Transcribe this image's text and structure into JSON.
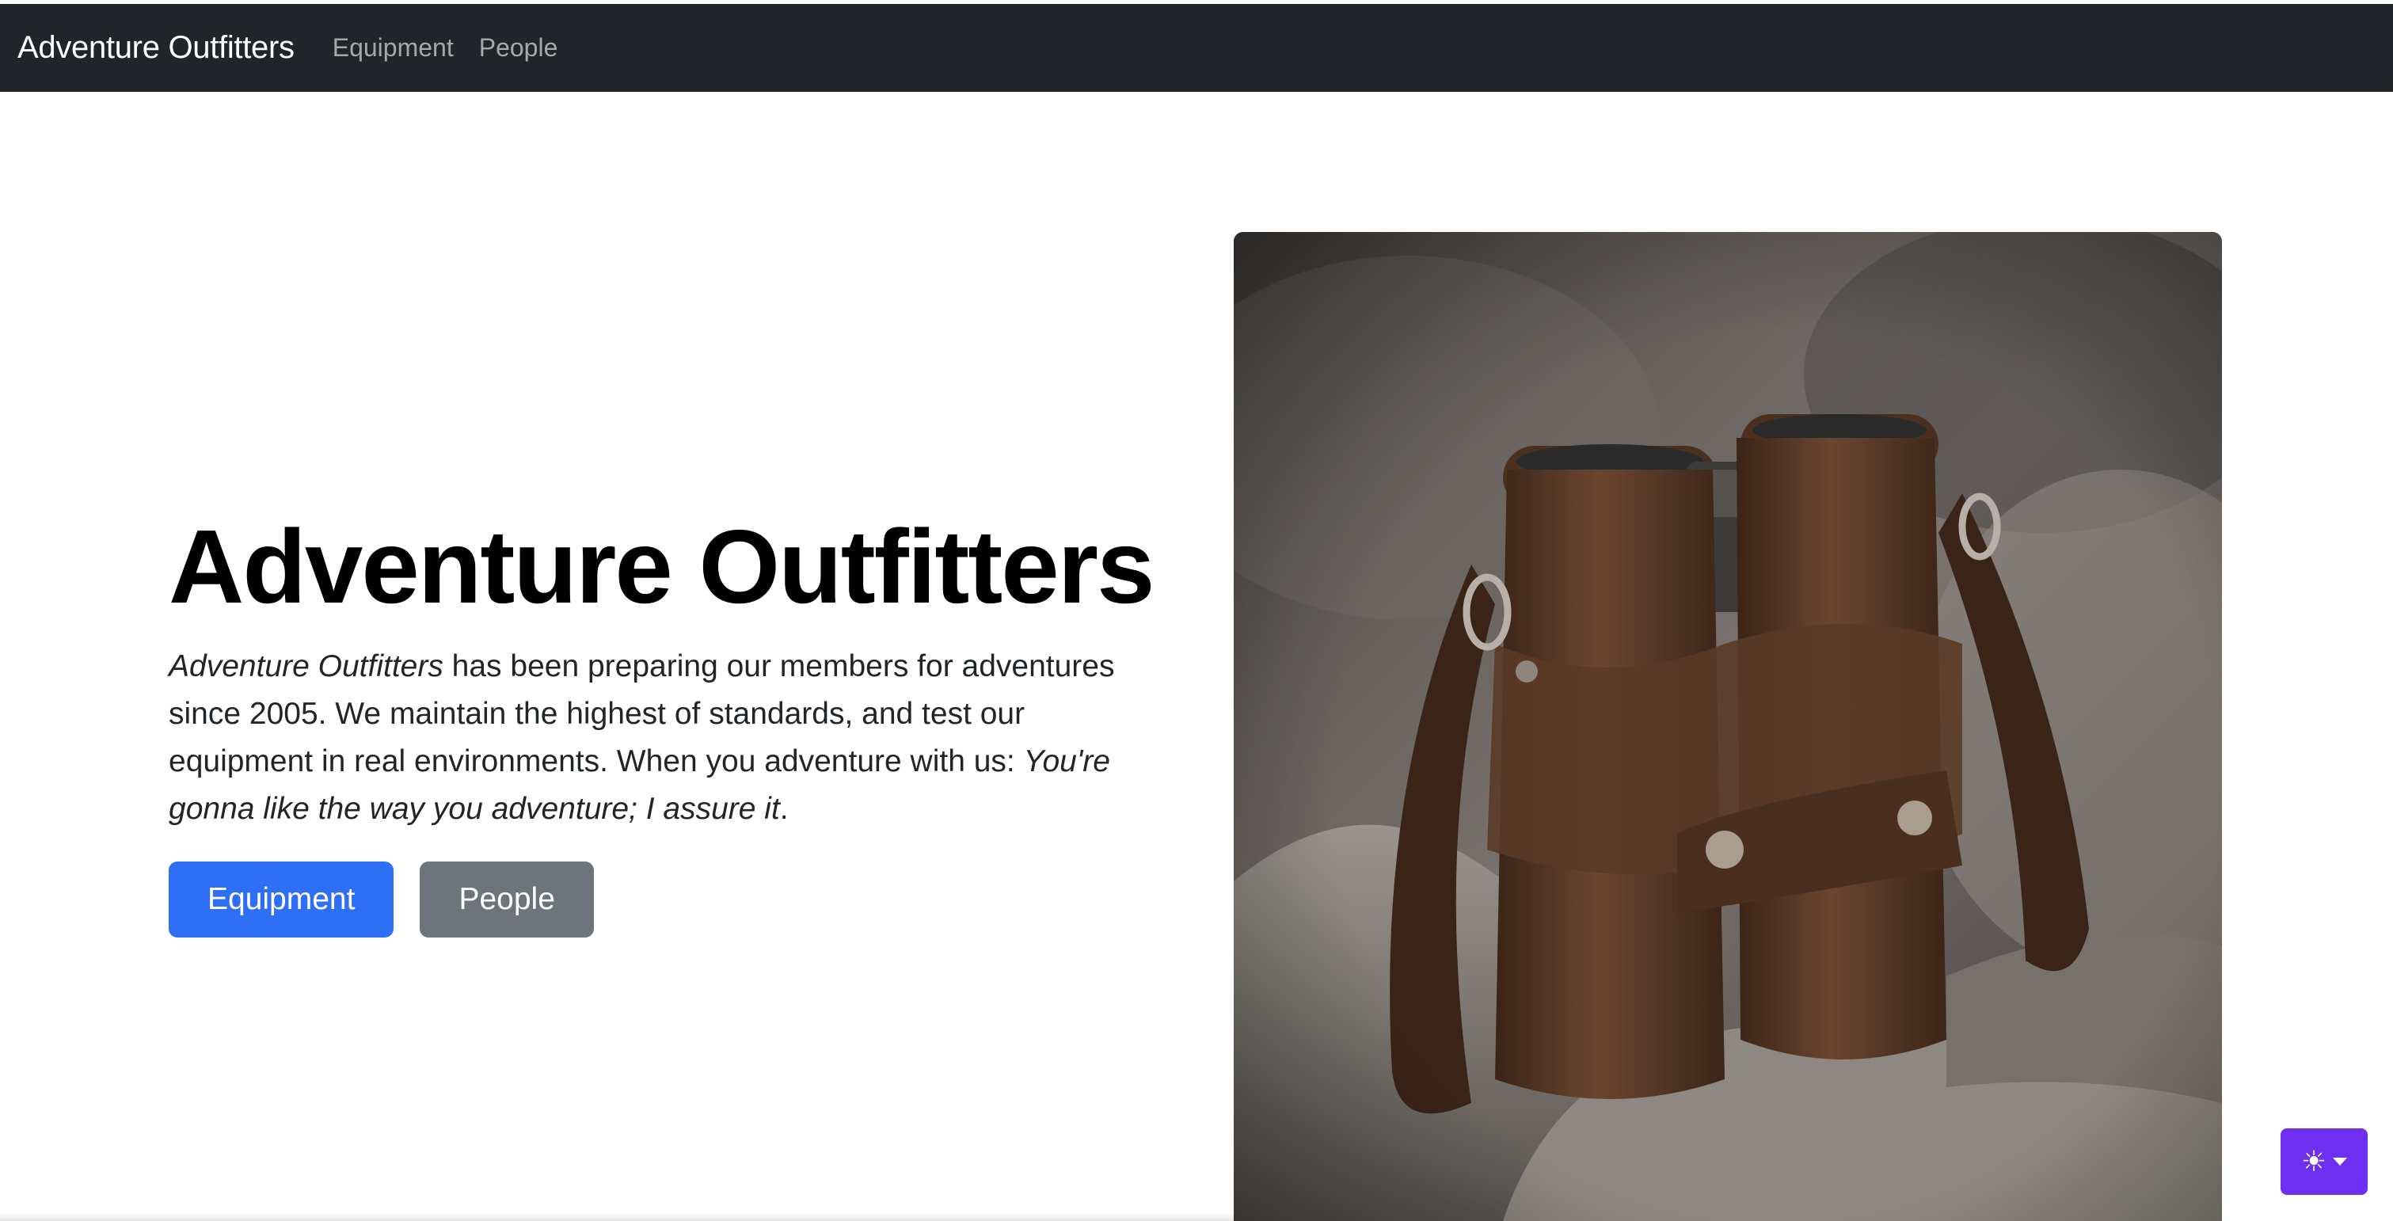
{
  "navbar": {
    "brand": "Adventure Outfitters",
    "links": [
      {
        "label": "Equipment"
      },
      {
        "label": "People"
      }
    ]
  },
  "hero": {
    "title": "Adventure Outfitters",
    "paragraph": {
      "lead_italic": "Adventure Outfitters",
      "body": " has been preparing our members for adventures since 2005. We maintain the highest of standards, and test our equipment in real environments. When you adventure with us: ",
      "closing_italic": "You're gonna like the way you adventure; I assure it",
      "end": "."
    },
    "buttons": {
      "primary": "Equipment",
      "secondary": "People"
    }
  },
  "image": {
    "alt": "Leather-cased binoculars on rocks",
    "subject": "binoculars"
  },
  "theme_toggle": {
    "icon": "sun-icon",
    "dropdown_icon": "caret-down-icon"
  },
  "colors": {
    "navbar_bg": "#212529",
    "primary_button": "#2f6ff5",
    "secondary_button": "#6c757d",
    "theme_toggle_bg": "#6f2ff0"
  }
}
